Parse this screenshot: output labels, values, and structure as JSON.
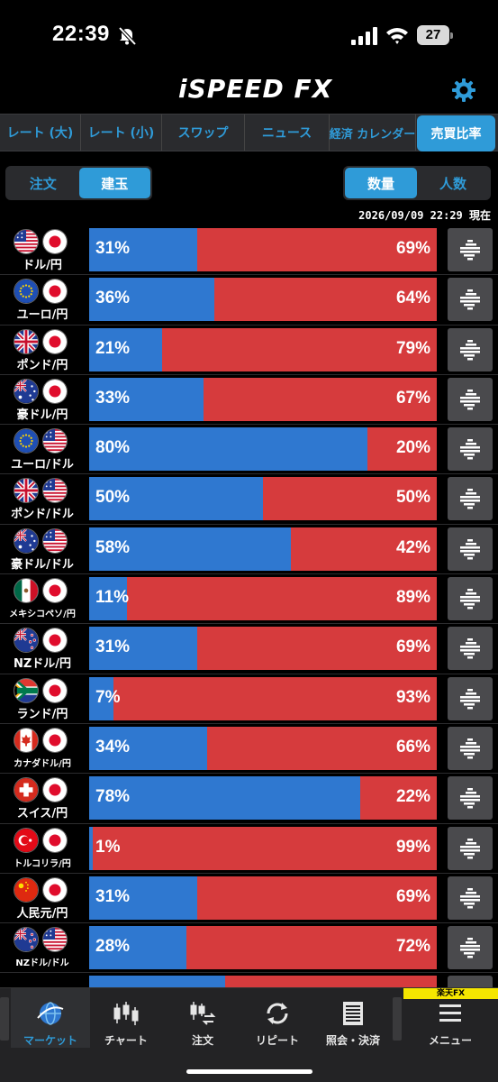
{
  "status": {
    "time": "22:39",
    "battery": "27"
  },
  "app": {
    "logo": "iSPEED FX"
  },
  "colors": {
    "accent": "#2f9bd8",
    "buy": "#2f78d0",
    "sell": "#d63b3d",
    "brand_badge": "#f5e600"
  },
  "top_tabs": [
    {
      "label": "レート (大)",
      "active": false
    },
    {
      "label": "レート (小)",
      "active": false
    },
    {
      "label": "スワップ",
      "active": false
    },
    {
      "label": "ニュース",
      "active": false
    },
    {
      "label": "経済 カレンダー",
      "active": false
    },
    {
      "label": "売買比率",
      "active": true
    }
  ],
  "order_toggle": {
    "left": "注文",
    "right": "建玉",
    "selected": "建玉"
  },
  "measure_toggle": {
    "left": "数量",
    "right": "人数",
    "selected": "数量"
  },
  "timestamp": "2026/09/09 22:29 現在",
  "rows": [
    {
      "label": "ドル/円",
      "flags": [
        "us-flag",
        "jp-flag"
      ],
      "buy": 31,
      "buy_text": "31%",
      "sell_text": "69%"
    },
    {
      "label": "ユーロ/円",
      "flags": [
        "eu-flag",
        "jp-flag"
      ],
      "buy": 36,
      "buy_text": "36%",
      "sell_text": "64%"
    },
    {
      "label": "ポンド/円",
      "flags": [
        "uk-flag",
        "jp-flag"
      ],
      "buy": 21,
      "buy_text": "21%",
      "sell_text": "79%"
    },
    {
      "label": "豪ドル/円",
      "flags": [
        "au-flag",
        "jp-flag"
      ],
      "buy": 33,
      "buy_text": "33%",
      "sell_text": "67%"
    },
    {
      "label": "ユーロ/ドル",
      "flags": [
        "eu-flag",
        "us-flag"
      ],
      "buy": 80,
      "buy_text": "80%",
      "sell_text": "20%"
    },
    {
      "label": "ポンド/ドル",
      "flags": [
        "uk-flag",
        "us-flag"
      ],
      "buy": 50,
      "buy_text": "50%",
      "sell_text": "50%"
    },
    {
      "label": "豪ドル/ドル",
      "flags": [
        "au-flag",
        "us-flag"
      ],
      "buy": 58,
      "buy_text": "58%",
      "sell_text": "42%"
    },
    {
      "label": "メキシコペソ/円",
      "flags": [
        "mx-flag",
        "jp-flag"
      ],
      "buy": 11,
      "buy_text": "11%",
      "sell_text": "89%",
      "small": true
    },
    {
      "label": "NZドル/円",
      "flags": [
        "nz-flag",
        "jp-flag"
      ],
      "buy": 31,
      "buy_text": "31%",
      "sell_text": "69%"
    },
    {
      "label": "ランド/円",
      "flags": [
        "za-flag",
        "jp-flag"
      ],
      "buy": 7,
      "buy_text": "7%",
      "sell_text": "93%"
    },
    {
      "label": "カナダドル/円",
      "flags": [
        "ca-flag",
        "jp-flag"
      ],
      "buy": 34,
      "buy_text": "34%",
      "sell_text": "66%",
      "small": true
    },
    {
      "label": "スイス/円",
      "flags": [
        "ch-flag",
        "jp-flag"
      ],
      "buy": 78,
      "buy_text": "78%",
      "sell_text": "22%"
    },
    {
      "label": "トルコリラ/円",
      "flags": [
        "tr-flag",
        "jp-flag"
      ],
      "buy": 1,
      "buy_text": "1%",
      "sell_text": "99%",
      "small": true
    },
    {
      "label": "人民元/円",
      "flags": [
        "cn-flag",
        "jp-flag"
      ],
      "buy": 31,
      "buy_text": "31%",
      "sell_text": "69%"
    },
    {
      "label": "NZドル/ドル",
      "flags": [
        "nz-flag",
        "us-flag"
      ],
      "buy": 28,
      "buy_text": "28%",
      "sell_text": "72%",
      "small": true
    }
  ],
  "partial_row": {
    "buy": 39
  },
  "bottom_nav": {
    "items": [
      {
        "label": "マーケット",
        "icon": "globe-icon",
        "active": true
      },
      {
        "label": "チャート",
        "icon": "candlestick-icon",
        "active": false
      },
      {
        "label": "注文",
        "icon": "order-icon",
        "active": false
      },
      {
        "label": "リピート",
        "icon": "repeat-icon",
        "active": false
      },
      {
        "label": "照会・決済",
        "icon": "document-icon",
        "active": false
      },
      {
        "label": "メニュー",
        "icon": "menu-icon",
        "active": false
      }
    ],
    "brand_badge": "楽天FX"
  }
}
